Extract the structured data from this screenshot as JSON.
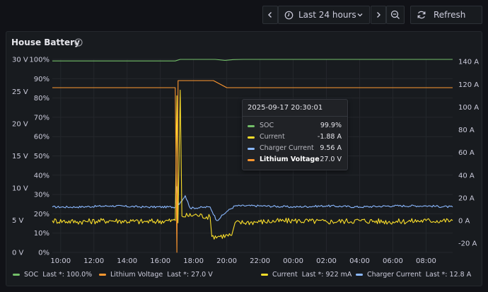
{
  "toolbar": {
    "time_range_label": "Last 24 hours",
    "refresh_label": "Refresh"
  },
  "panel": {
    "title": "House Battery"
  },
  "colors": {
    "soc": "#73bf69",
    "lithium_voltage": "#ff9830",
    "current": "#fade2a",
    "charger_current": "#8ab8ff"
  },
  "tooltip": {
    "timestamp": "2025-09-17 20:30:01",
    "rows": [
      {
        "name": "SOC",
        "value": "99.9%"
      },
      {
        "name": "Current",
        "value": "-1.88 A"
      },
      {
        "name": "Charger Current",
        "value": "9.56 A"
      },
      {
        "name": "Lithium Voltage",
        "value": "27.0 V"
      }
    ]
  },
  "legend": [
    {
      "name": "SOC",
      "last": "Last *: 100.0%"
    },
    {
      "name": "Lithium Voltage",
      "last": "Last *: 27.0 V"
    },
    {
      "name": "Current",
      "last": "Last *: 922 mA"
    },
    {
      "name": "Charger Current",
      "last": "Last *: 12.8 A"
    }
  ],
  "chart_data": {
    "type": "line",
    "title": "House Battery",
    "x_ticks": [
      "10:00",
      "12:00",
      "14:00",
      "16:00",
      "18:00",
      "20:00",
      "22:00",
      "00:00",
      "02:00",
      "04:00",
      "06:00",
      "08:00"
    ],
    "axes": {
      "voltage": {
        "position": "left-outer",
        "ticks": [
          "0 V",
          "5 V",
          "10 V",
          "15 V",
          "20 V",
          "25 V",
          "30 V"
        ],
        "range": [
          0,
          30
        ],
        "unit": "V"
      },
      "percent": {
        "position": "left-inner",
        "ticks": [
          "0%",
          "10%",
          "20%",
          "30%",
          "40%",
          "50%",
          "60%",
          "70%",
          "80%",
          "90%",
          "100%"
        ],
        "range": [
          0,
          100
        ],
        "unit": "%"
      },
      "current": {
        "position": "right",
        "ticks": [
          "-20 A",
          "0 A",
          "20 A",
          "40 A",
          "60 A",
          "80 A",
          "100 A",
          "120 A",
          "140 A"
        ],
        "range": [
          -28,
          142
        ],
        "unit": "A"
      }
    },
    "x_range_hours": [
      9.5,
      33.6
    ],
    "grid": true,
    "legend_placement": "bottom",
    "series": [
      {
        "name": "SOC",
        "axis": "percent",
        "points": [
          [
            9.5,
            99.2
          ],
          [
            16.9,
            99.2
          ],
          [
            17.2,
            100
          ],
          [
            19.3,
            100
          ],
          [
            19.9,
            99.5
          ],
          [
            20.4,
            99.9
          ],
          [
            21.0,
            100
          ],
          [
            33.6,
            100
          ]
        ]
      },
      {
        "name": "Lithium Voltage",
        "axis": "voltage",
        "points": [
          [
            9.5,
            25.6
          ],
          [
            16.9,
            25.6
          ],
          [
            17.0,
            0
          ],
          [
            17.07,
            26.7
          ],
          [
            17.15,
            26.7
          ],
          [
            19.2,
            26.7
          ],
          [
            20.0,
            25.6
          ],
          [
            33.6,
            25.6
          ]
        ]
      },
      {
        "name": "Current",
        "axis": "current",
        "points": [
          [
            9.5,
            0
          ],
          [
            11,
            -1
          ],
          [
            13,
            0
          ],
          [
            15,
            -1
          ],
          [
            16.9,
            0
          ],
          [
            17.0,
            110
          ],
          [
            17.06,
            -2
          ],
          [
            17.2,
            115
          ],
          [
            17.3,
            4
          ],
          [
            18.2,
            5
          ],
          [
            19.0,
            3
          ],
          [
            19.1,
            -14
          ],
          [
            20.3,
            -13
          ],
          [
            20.5,
            -2
          ],
          [
            22,
            -1
          ],
          [
            24,
            0
          ],
          [
            26,
            -1
          ],
          [
            28,
            0
          ],
          [
            30,
            -1
          ],
          [
            32,
            0
          ],
          [
            33.6,
            0
          ]
        ]
      },
      {
        "name": "Charger Current",
        "axis": "current",
        "points": [
          [
            9.5,
            12
          ],
          [
            11,
            12
          ],
          [
            13,
            13
          ],
          [
            15,
            12
          ],
          [
            16.9,
            12
          ],
          [
            17.0,
            30
          ],
          [
            17.1,
            14
          ],
          [
            17.5,
            22
          ],
          [
            17.8,
            11
          ],
          [
            19.0,
            12
          ],
          [
            19.4,
            0
          ],
          [
            20.0,
            8
          ],
          [
            20.5,
            13
          ],
          [
            22,
            13
          ],
          [
            24,
            12
          ],
          [
            26,
            13
          ],
          [
            28,
            12
          ],
          [
            30,
            13
          ],
          [
            32,
            13
          ],
          [
            33.6,
            12
          ]
        ]
      }
    ]
  }
}
